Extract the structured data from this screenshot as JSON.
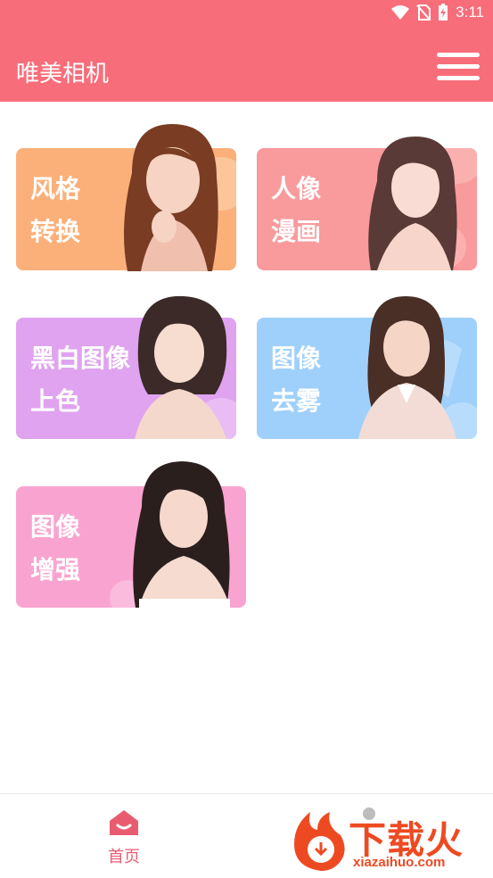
{
  "status_bar": {
    "time": "3:11",
    "icons": [
      "wifi-icon",
      "no-sim-icon",
      "battery-charging-icon"
    ]
  },
  "app_bar": {
    "title": "唯美相机",
    "menu_icon": "hamburger-menu-icon"
  },
  "cards": [
    {
      "line1": "风格",
      "line2": "转换",
      "color": "#fbb07a"
    },
    {
      "line1": "人像",
      "line2": "漫画",
      "color": "#f99a9c"
    },
    {
      "line1": "黑白图像",
      "line2": "上色",
      "color": "#e0a3f0"
    },
    {
      "line1": "图像",
      "line2": "去雾",
      "color": "#9fd0fb"
    },
    {
      "line1": "图像",
      "line2": "增强",
      "color": "#f9a4d0"
    }
  ],
  "bottom_nav": {
    "home_label": "首页",
    "home_icon": "home-icon",
    "accent": "#e95c70"
  },
  "watermark": {
    "text": "下载火",
    "sub": "xiazaihuo.com"
  }
}
